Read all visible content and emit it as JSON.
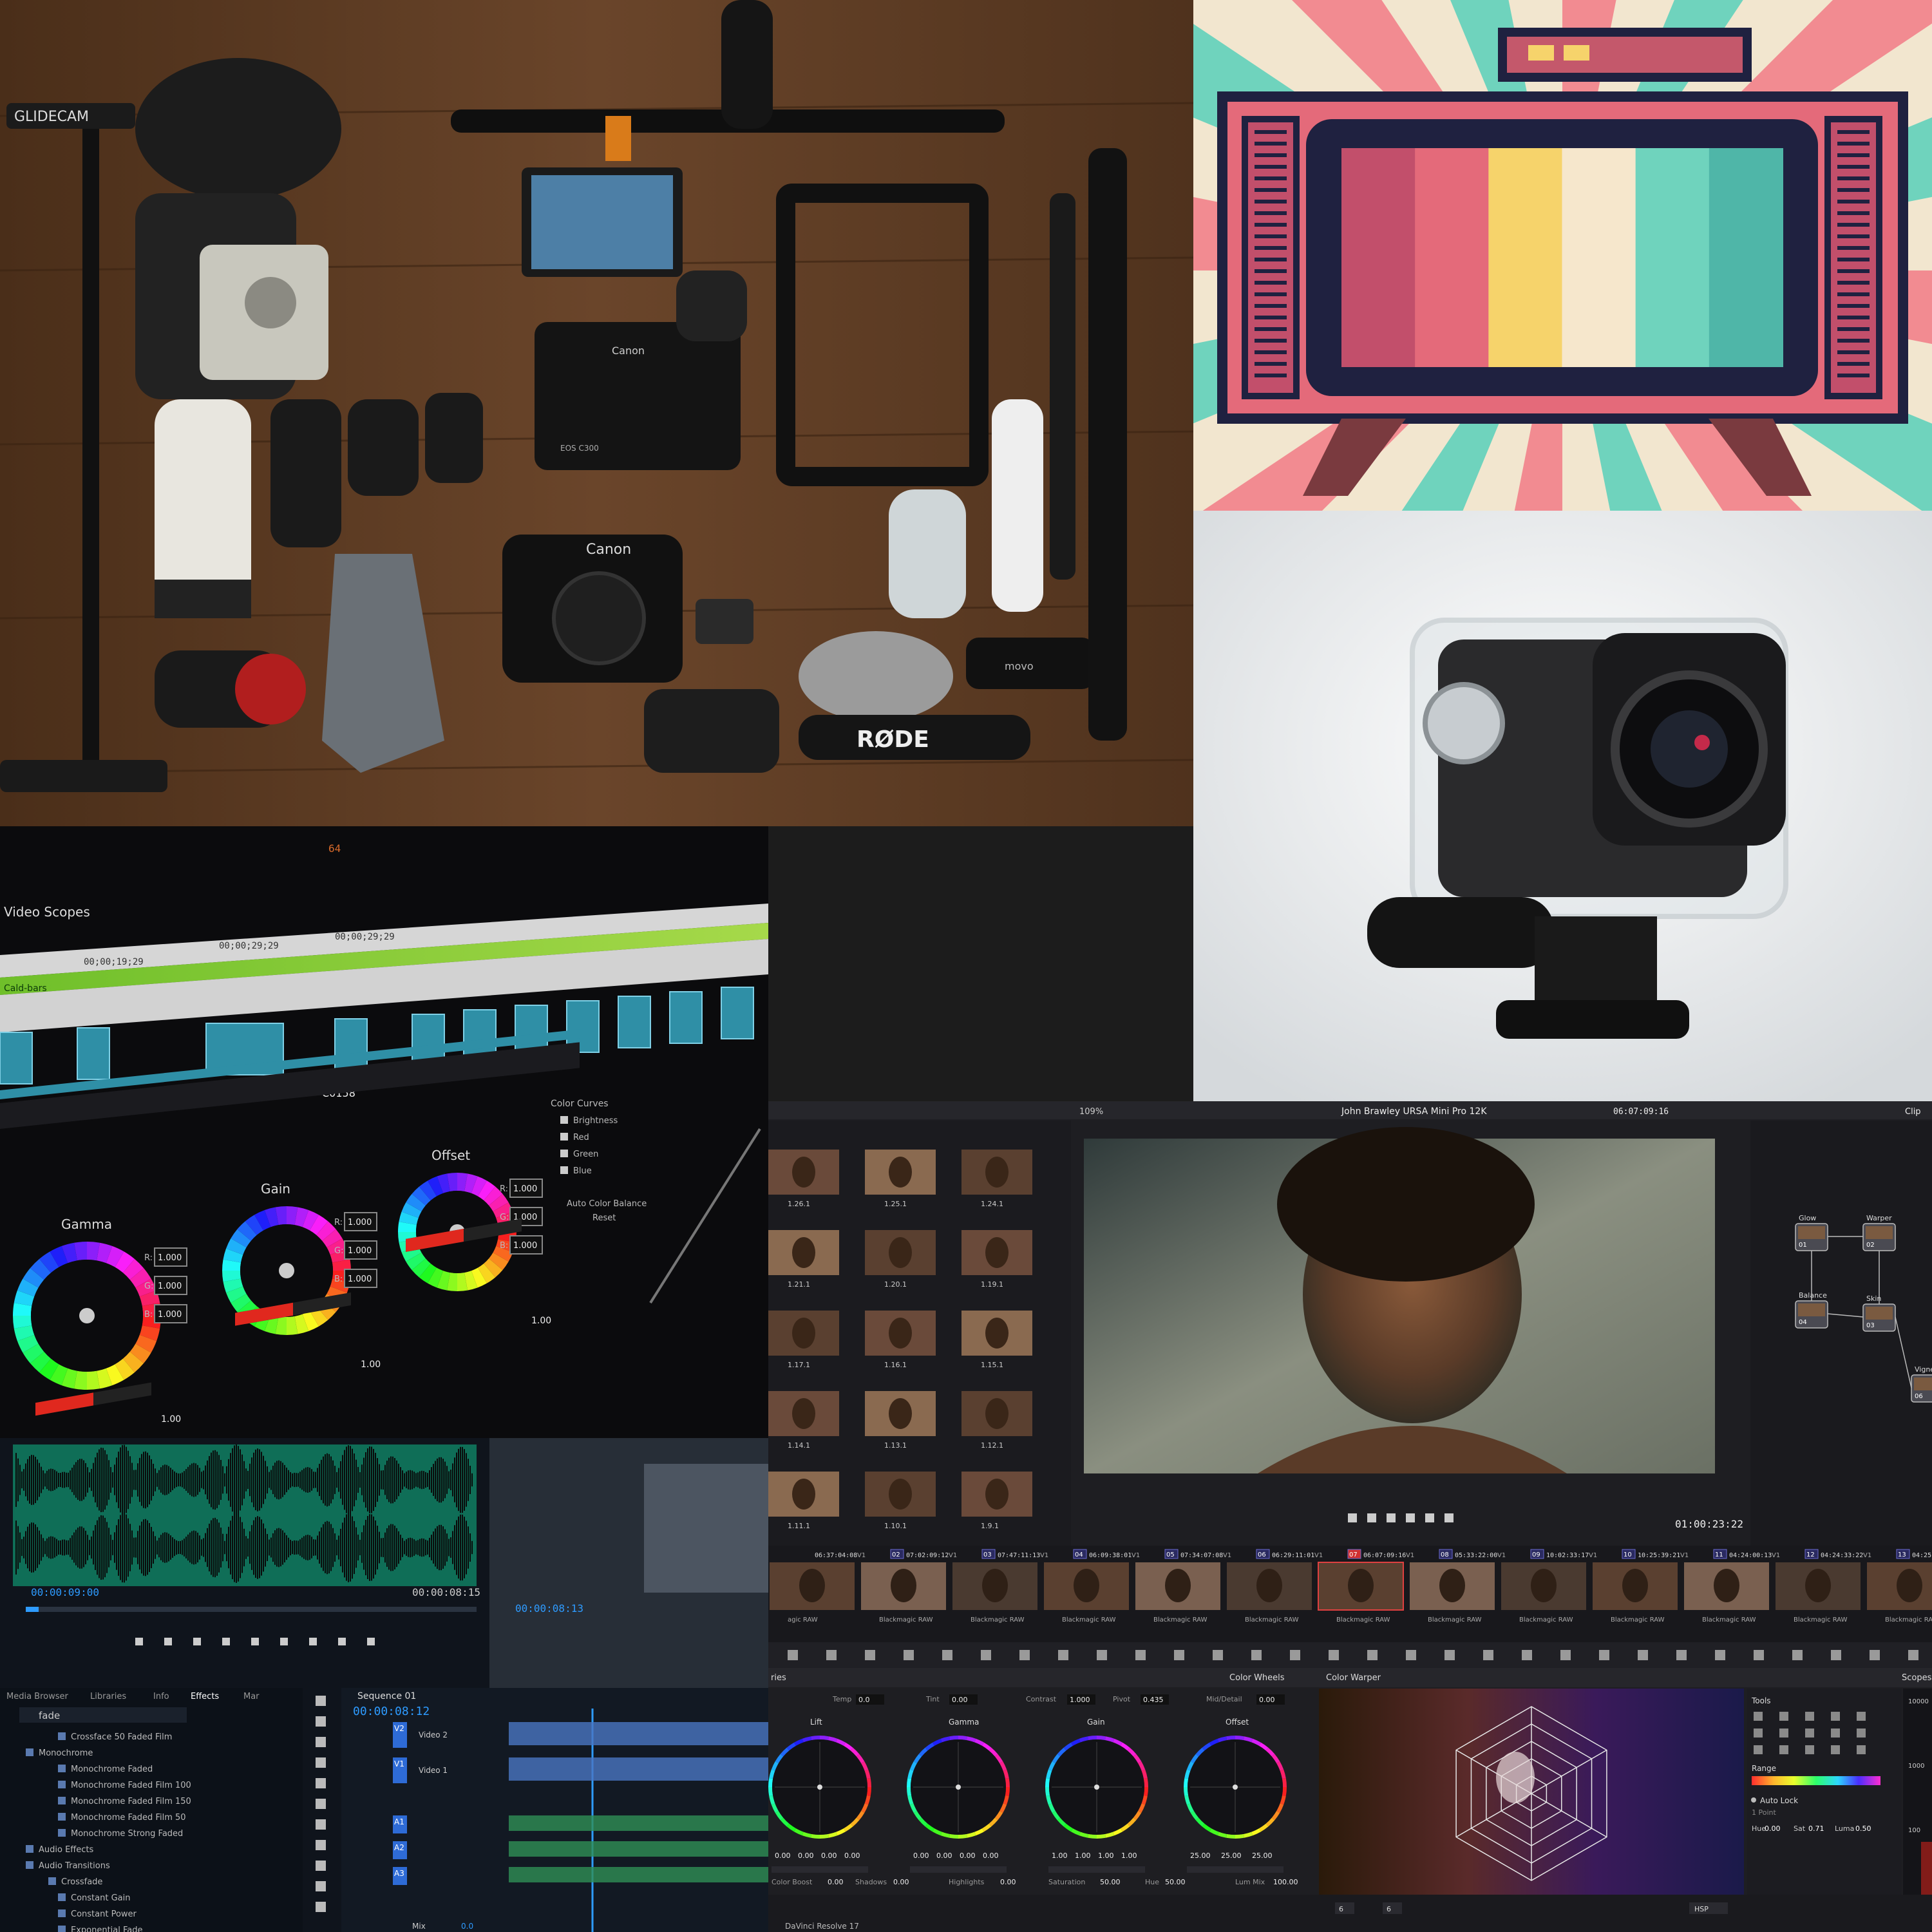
{
  "gear_photo": {
    "brand_glidecam": "GLIDECAM",
    "brand_canon_top": "Canon",
    "brand_canon_body": "Canon",
    "brand_eos": "EOS C300",
    "brand_rode": "RØDE",
    "brand_movo": "movo"
  },
  "tv_pixel_art": {
    "colors": {
      "rays_teal": "#6fd3bd",
      "rays_pink": "#f28b91",
      "cream": "#f6e7cc",
      "body": "#e46a7a",
      "frame": "#1f2140",
      "legs": "#7a3a3f"
    },
    "bars": [
      "#c24f6b",
      "#e46a7a",
      "#f6d36b",
      "#f6e7cc",
      "#6fd3bd",
      "#4fb6a8"
    ]
  },
  "action_cam": {
    "colors": {
      "housing": "#dfe5e8",
      "body": "#2a2a2c",
      "lens_ring": "#1a1a1c"
    }
  },
  "scopes_editor": {
    "panel_title": "Video Scopes",
    "timecodes": [
      "00;00;29;29",
      "00;00;29;29",
      "00;00;19;29"
    ],
    "clip_label": "C0158",
    "clip_label_top": "Cald-bars",
    "wheels": [
      {
        "name": "Gamma",
        "values": [
          "1.000",
          "1.000",
          "1.000"
        ]
      },
      {
        "name": "Gain",
        "values": [
          "1.000",
          "1.000",
          "1.000"
        ]
      },
      {
        "name": "Offset",
        "values": [
          "1.000",
          "1.000",
          "1.000"
        ]
      }
    ],
    "right_panel": {
      "title": "Color Curves",
      "options": [
        "Brightness",
        "Red",
        "Green",
        "Blue"
      ],
      "button": "Auto Color Balance",
      "reset": "Reset"
    },
    "y_values": [
      "1.00",
      "1.00",
      "1.00"
    ],
    "top_value": "64"
  },
  "audio_editor": {
    "timecode_left": "00:00:09:00",
    "timecode_right": "00:00:08:15",
    "timecode_program": "00:00:08:13",
    "tabs": [
      "Media Browser",
      "Libraries",
      "Info",
      "Effects",
      "Mar"
    ],
    "search_value": "fade",
    "effects_list": [
      "Crossface 50 Faded Film",
      "Monochrome",
      "Monochrome Faded",
      "Monochrome Faded Film 100",
      "Monochrome Faded Film 150",
      "Monochrome Faded Film 50",
      "Monochrome Strong Faded",
      "Audio Effects",
      "Audio Transitions",
      "Crossfade",
      "Constant Gain",
      "Constant Power",
      "Exponential Fade"
    ],
    "sequence_tab": "Sequence 01",
    "sequence_timecode": "00:00:08:12",
    "tracks": [
      "V2",
      "Video 2",
      "V1",
      "Video 1",
      "A1",
      "A2",
      "A3"
    ],
    "mix_label": "Mix",
    "mix_value": "0.0"
  },
  "resolve": {
    "zoom": "109%",
    "clip_title": "John Brawley URSA Mini Pro 12K",
    "timecode_top": "06:07:09:16",
    "clip_label_right": "Clip",
    "viewer_timecode": "01:00:23:22",
    "gallery_labels": [
      "1.26.1",
      "1.25.1",
      "1.24.1",
      "1.21.1",
      "1.20.1",
      "1.19.1",
      "1.17.1",
      "1.16.1",
      "1.15.1",
      "1.14.1",
      "1.13.1",
      "1.12.1",
      "1.11.1",
      "1.10.1",
      "1.9.1"
    ],
    "nodes": [
      {
        "name": "Glow",
        "num": "01"
      },
      {
        "name": "Warper",
        "num": "02"
      },
      {
        "name": "Balance",
        "num": "04"
      },
      {
        "name": "Skin",
        "num": "03"
      },
      {
        "name": "Vignet",
        "num": "06"
      }
    ],
    "clips": [
      {
        "num": "",
        "tc": "06:37:04:08",
        "track": "V1",
        "label": "agic RAW"
      },
      {
        "num": "02",
        "tc": "07:02:09:12",
        "track": "V1",
        "label": "Blackmagic RAW"
      },
      {
        "num": "03",
        "tc": "07:47:11:13",
        "track": "V1",
        "label": "Blackmagic RAW"
      },
      {
        "num": "04",
        "tc": "06:09:38:01",
        "track": "V1",
        "label": "Blackmagic RAW"
      },
      {
        "num": "05",
        "tc": "07:34:07:08",
        "track": "V1",
        "label": "Blackmagic RAW"
      },
      {
        "num": "06",
        "tc": "06:29:11:01",
        "track": "V1",
        "label": "Blackmagic RAW"
      },
      {
        "num": "07",
        "tc": "06:07:09:16",
        "track": "V1",
        "label": "Blackmagic RAW"
      },
      {
        "num": "08",
        "tc": "05:33:22:00",
        "track": "V1",
        "label": "Blackmagic RAW"
      },
      {
        "num": "09",
        "tc": "10:02:33:17",
        "track": "V1",
        "label": "Blackmagic RAW"
      },
      {
        "num": "10",
        "tc": "10:25:39:21",
        "track": "V1",
        "label": "Blackmagic RAW"
      },
      {
        "num": "11",
        "tc": "04:24:00:13",
        "track": "V1",
        "label": "Blackmagic RAW"
      },
      {
        "num": "12",
        "tc": "04:24:33:22",
        "track": "V1",
        "label": "Blackmagic RAW"
      },
      {
        "num": "13",
        "tc": "04:25:02:06",
        "track": "V1",
        "label": "Blackmagic RAW"
      }
    ],
    "color_wheels_title": "Color Wheels",
    "color_warper_title": "Color Warper",
    "scopes_title": "Scopes",
    "prims_label": "ries",
    "params": [
      {
        "name": "Temp",
        "value": "0.0"
      },
      {
        "name": "Tint",
        "value": "0.00"
      },
      {
        "name": "Contrast",
        "value": "1.000"
      },
      {
        "name": "Pivot",
        "value": "0.435"
      },
      {
        "name": "Mid/Detail",
        "value": "0.00"
      }
    ],
    "wheels": [
      {
        "name": "Lift",
        "values": [
          "0.00",
          "0.00",
          "0.00",
          "0.00"
        ]
      },
      {
        "name": "Gamma",
        "values": [
          "0.00",
          "0.00",
          "0.00",
          "0.00"
        ]
      },
      {
        "name": "Gain",
        "values": [
          "1.00",
          "1.00",
          "1.00",
          "1.00"
        ]
      },
      {
        "name": "Offset",
        "values": [
          "25.00",
          "25.00",
          "25.00"
        ]
      }
    ],
    "bottom_params": [
      {
        "name": "Color Boost",
        "value": "0.00"
      },
      {
        "name": "Shadows",
        "value": "0.00"
      },
      {
        "name": "Highlights",
        "value": "0.00"
      },
      {
        "name": "Saturation",
        "value": "50.00"
      },
      {
        "name": "Hue",
        "value": "50.00"
      },
      {
        "name": "Lum Mix",
        "value": "100.00"
      }
    ],
    "tools": {
      "title": "Tools",
      "range": "Range",
      "auto_lock": "Auto Lock",
      "hue_label": "Hue",
      "hue_value": "0.00",
      "sat_label": "Sat",
      "sat_value": "0.71",
      "luma_label": "Luma",
      "luma_value": "0.50",
      "hsp": "HSP",
      "point_label": "1 Point"
    },
    "scope_values": [
      "10000",
      "1000",
      "100"
    ],
    "footer_app": "DaVinci Resolve 17",
    "footer_dropdown_a": "6",
    "footer_dropdown_b": "6"
  }
}
